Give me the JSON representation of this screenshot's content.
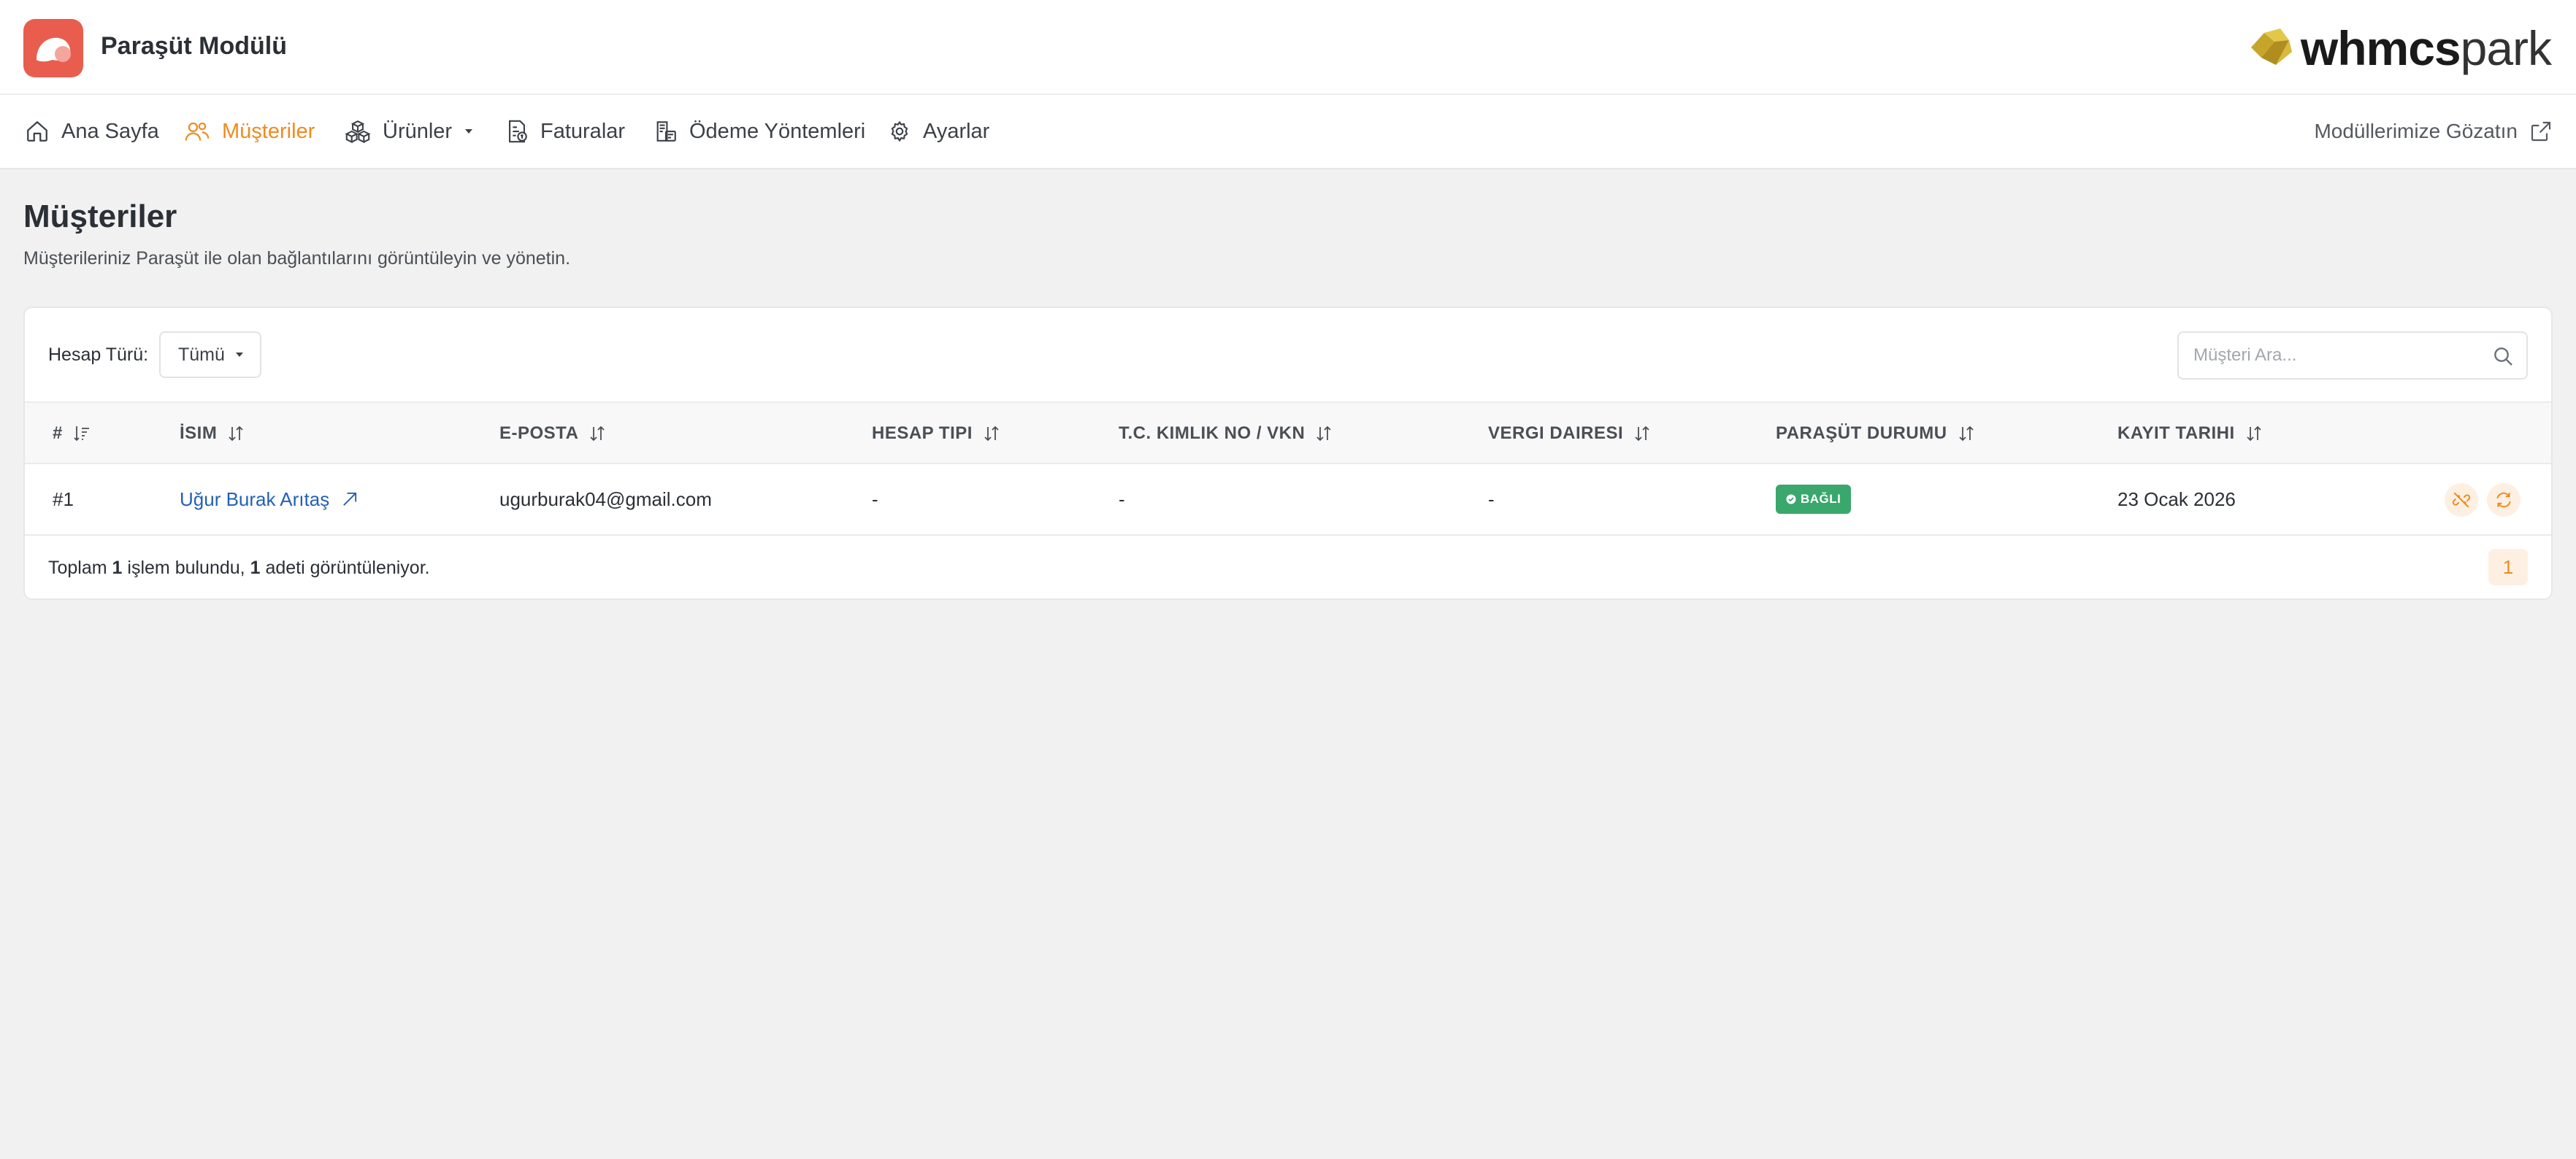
{
  "app": {
    "title": "Paraşüt Modülü",
    "brand_bold": "whmcs",
    "brand_light": "park"
  },
  "nav": {
    "items": [
      {
        "label": "Ana Sayfa",
        "icon": "home-icon"
      },
      {
        "label": "Müşteriler",
        "icon": "users-icon",
        "active": true
      },
      {
        "label": "Ürünler",
        "icon": "boxes-icon",
        "dropdown": true
      },
      {
        "label": "Faturalar",
        "icon": "invoice-icon"
      },
      {
        "label": "Ödeme Yöntemleri",
        "icon": "payment-methods-icon"
      },
      {
        "label": "Ayarlar",
        "icon": "gear-icon"
      }
    ],
    "external_link": "Modüllerimize Gözatın"
  },
  "page": {
    "title": "Müşteriler",
    "subtitle": "Müşterileriniz Paraşüt ile olan bağlantılarını görüntüleyin ve yönetin."
  },
  "filter": {
    "label": "Hesap Türü:",
    "selected": "Tümü"
  },
  "search": {
    "placeholder": "Müşteri Ara..."
  },
  "table": {
    "columns": [
      "#",
      "İSIM",
      "E-POSTA",
      "HESAP TIPI",
      "T.C. KIMLIK NO / VKN",
      "VERGI DAIRESI",
      "PARAŞÜT DURUMU",
      "KAYIT TARIHI"
    ],
    "rows": [
      {
        "id": "#1",
        "name": "Uğur Burak Arıtaş",
        "email": "ugurburak04@gmail.com",
        "account_type": "-",
        "tax_id": "-",
        "tax_office": "-",
        "status": "BAĞLI",
        "registered": "23 Ocak 2026"
      }
    ]
  },
  "footer": {
    "prefix": "Toplam",
    "total": "1",
    "middle": "işlem bulundu,",
    "shown": "1",
    "suffix": "adeti görüntüleniyor."
  },
  "pagination": {
    "current": "1"
  },
  "colors": {
    "accent": "#f08a1f",
    "logo": "#e95d4f",
    "link": "#2361b5",
    "status_ok": "#3aa76d"
  }
}
